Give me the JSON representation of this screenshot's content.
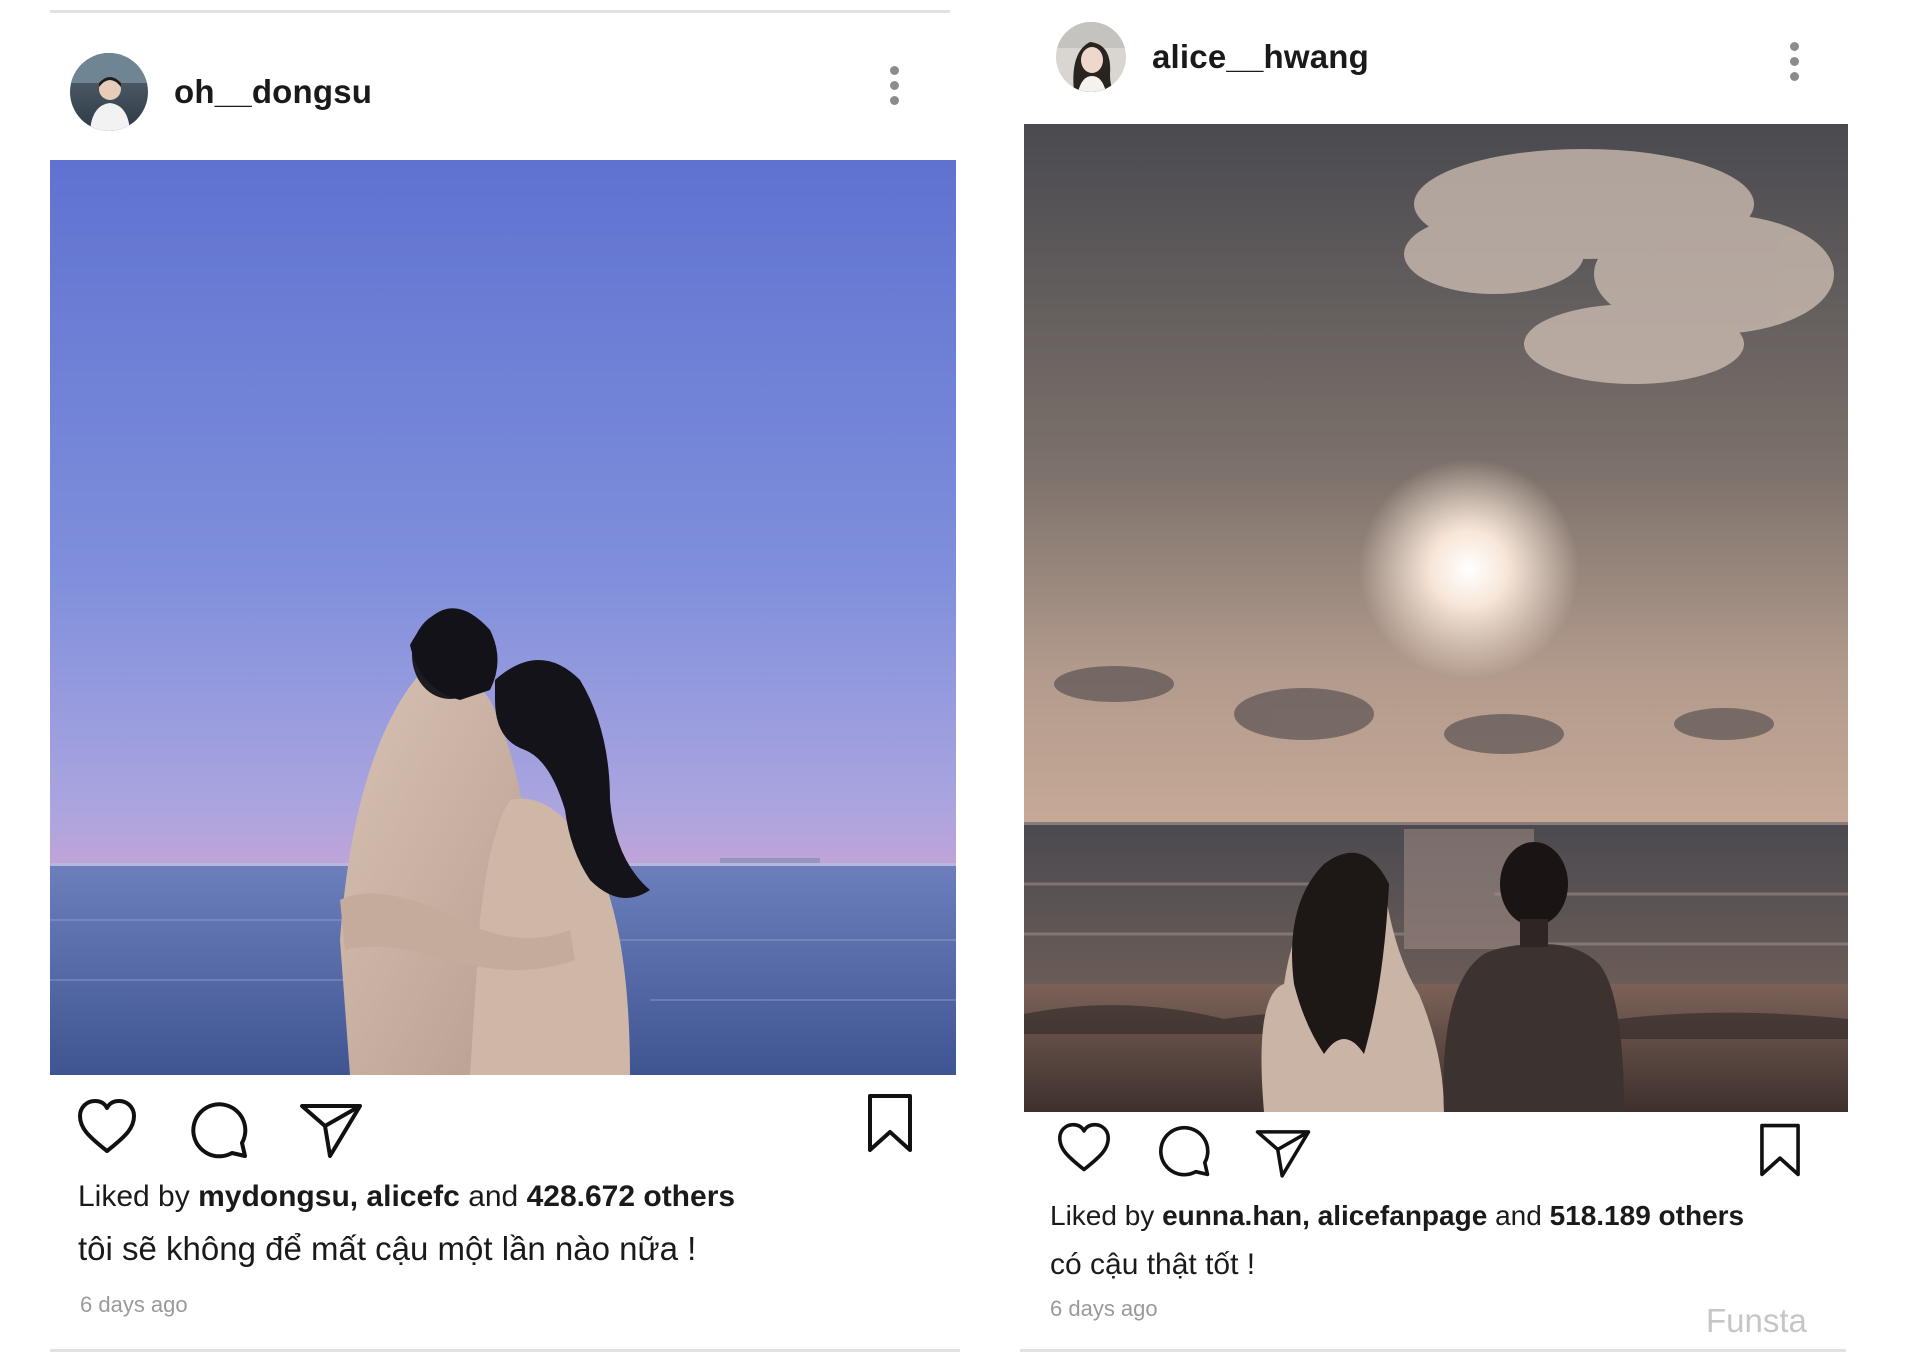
{
  "posts": [
    {
      "username": "oh__dongsu",
      "liked_by_prefix": "Liked by",
      "liked_by_users": "mydongsu, alicefc",
      "liked_by_connector": "and",
      "liked_by_count": "428.672 others",
      "caption": "tôi sẽ không để mất cậu một lần nào nữa !",
      "timestamp": "6 days ago",
      "photo": "couple-hugging-by-the-sea-at-dusk"
    },
    {
      "username": "alice__hwang",
      "liked_by_prefix": "Liked by",
      "liked_by_users": "eunna.han, alicefanpage",
      "liked_by_connector": "and",
      "liked_by_count": "518.189 others",
      "caption": "có cậu thật tốt !",
      "timestamp": "6 days ago",
      "photo": "couple-sitting-on-beach-under-cloudy-sun"
    }
  ],
  "watermark": "Funsta",
  "icons": [
    "more-icon",
    "heart-icon",
    "comment-icon",
    "share-icon",
    "bookmark-icon"
  ],
  "colors": {
    "text": "#1a1a1a",
    "muted": "#9a9a9a",
    "watermark": "#c6c6c6",
    "divider": "#e2e2e2"
  }
}
